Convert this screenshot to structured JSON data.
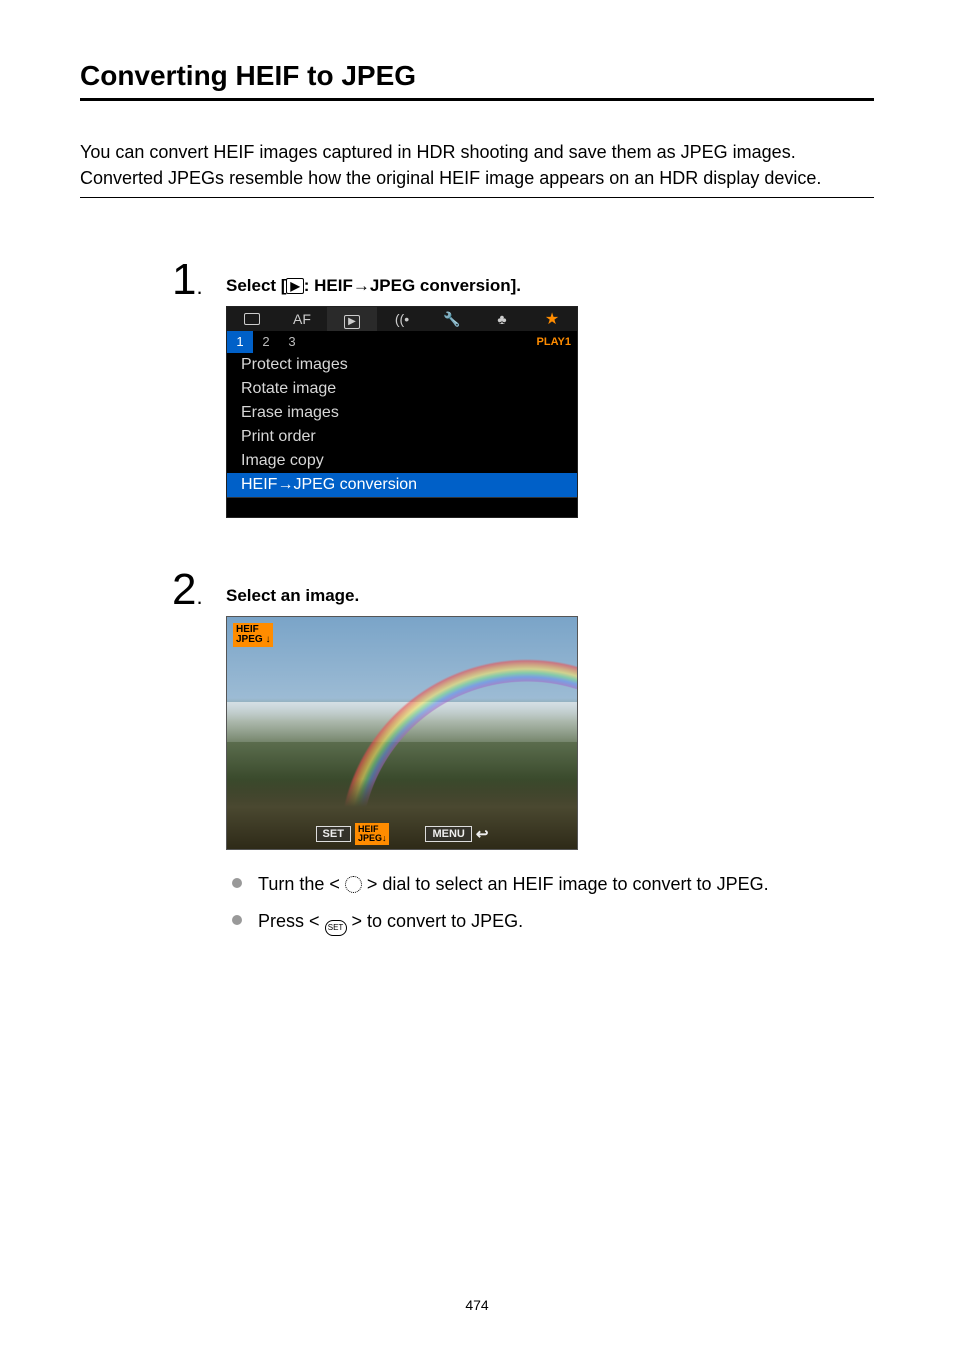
{
  "title": "Converting HEIF to JPEG",
  "intro": "You can convert HEIF images captured in HDR shooting and save them as JPEG images. Converted JPEGs resemble how the original HEIF image appears on an HDR display device.",
  "step1": {
    "num": "1",
    "heading_pre": "Select [",
    "heading_post": ": HEIF→JPEG conversion].",
    "menu": {
      "tab_af": "AF",
      "subtabs": [
        "1",
        "2",
        "3"
      ],
      "page_label": "PLAY1",
      "items": [
        "Protect images",
        "Rotate image",
        "Erase images",
        "Print order",
        "Image copy",
        "HEIF→JPEG conversion"
      ],
      "selected_index": 5
    }
  },
  "step2": {
    "num": "2",
    "heading": "Select an image.",
    "top_tag_line1": "HEIF",
    "top_tag_line2": "JPEG",
    "btn_set": "SET",
    "btn_tag_line1": "HEIF",
    "btn_tag_line2": "JPEG",
    "btn_menu": "MENU",
    "bullets": {
      "b1_pre": "Turn the < ",
      "b1_post": " > dial to select an HEIF image to convert to JPEG.",
      "b2_pre": "Press < ",
      "b2_mid": "SET",
      "b2_post": " > to convert to JPEG."
    }
  },
  "page_number": "474"
}
